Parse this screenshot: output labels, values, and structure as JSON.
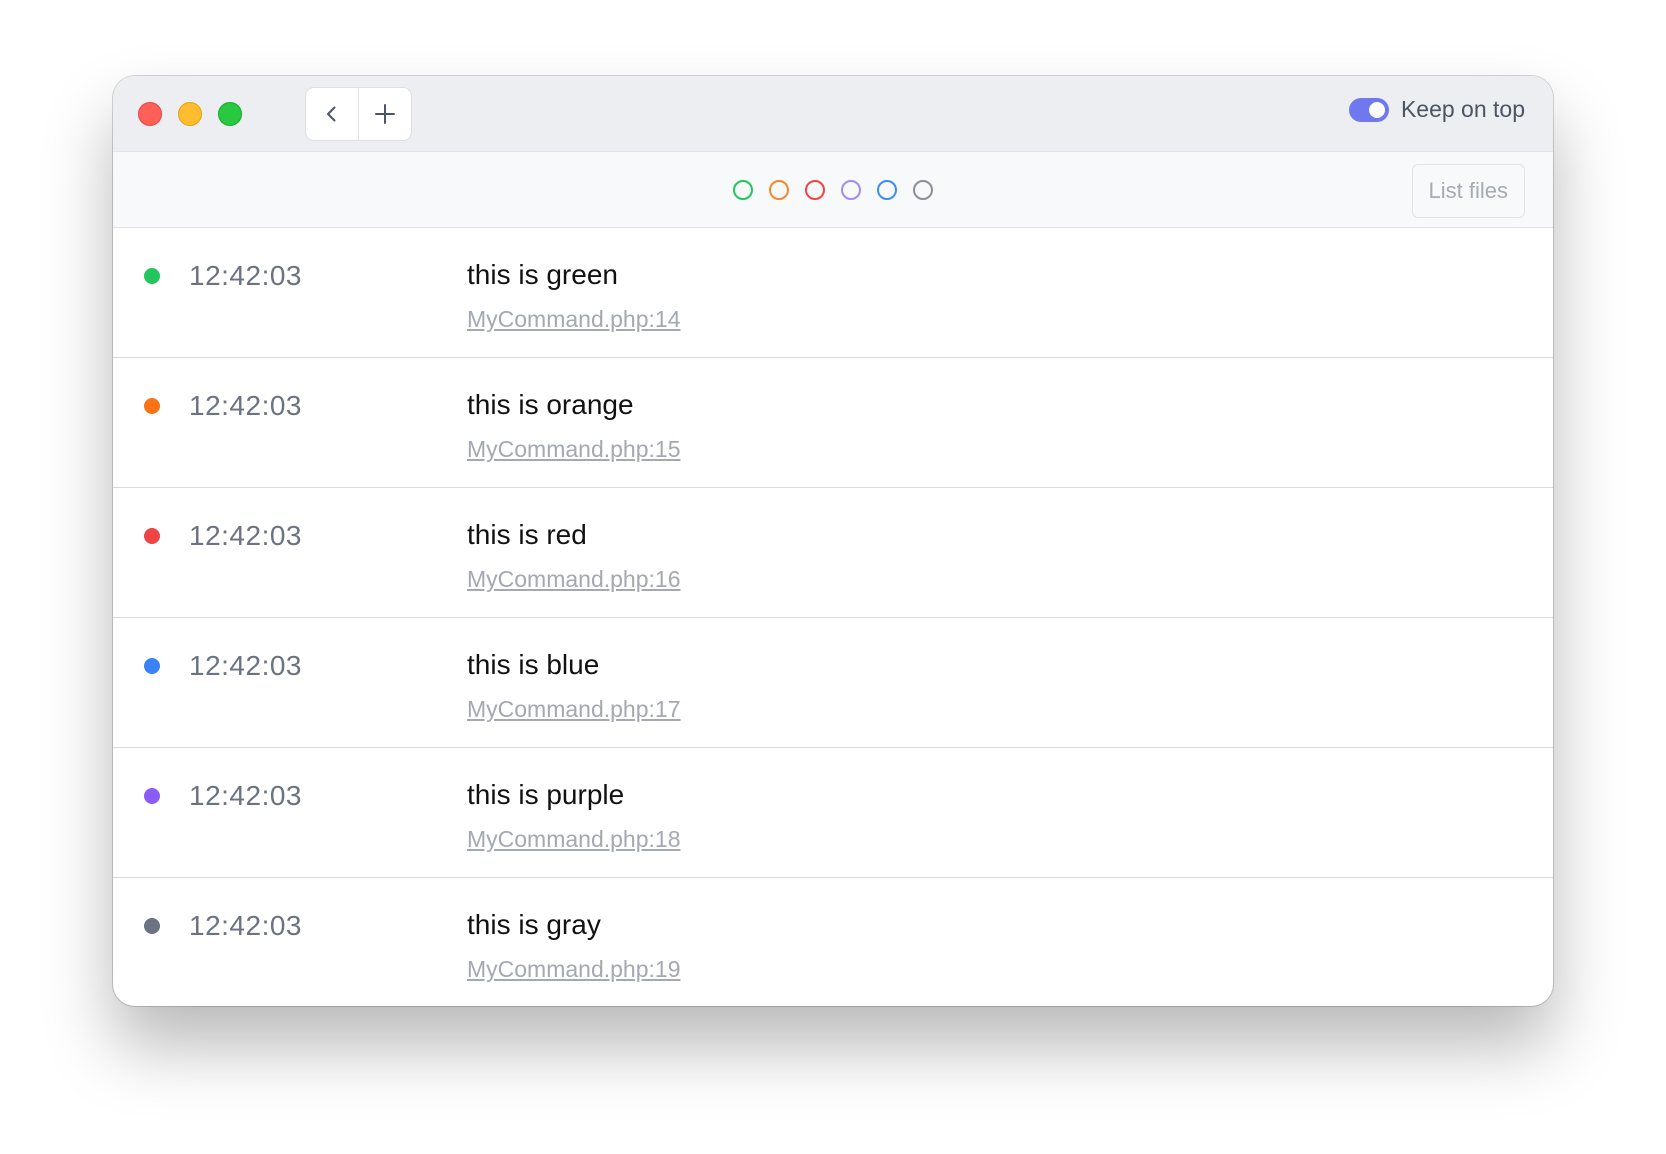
{
  "titlebar": {
    "back_icon": "chevron-left-icon",
    "add_icon": "plus-icon",
    "keep_on_top": {
      "label": "Keep on top",
      "enabled": true,
      "color": "#6f78ee"
    }
  },
  "filters": {
    "colors": [
      {
        "name": "green",
        "color": "#22c55e"
      },
      {
        "name": "orange",
        "color": "#f08a28"
      },
      {
        "name": "red",
        "color": "#ef4444"
      },
      {
        "name": "purple",
        "color": "#a58af0"
      },
      {
        "name": "blue",
        "color": "#3b8ff0"
      },
      {
        "name": "gray",
        "color": "#8a8f98"
      }
    ],
    "list_files_label": "List files"
  },
  "entries": [
    {
      "color": "#22c55e",
      "time": "12:42:03",
      "message": "this is green",
      "source": "MyCommand.php:14"
    },
    {
      "color": "#f97316",
      "time": "12:42:03",
      "message": "this is orange",
      "source": "MyCommand.php:15"
    },
    {
      "color": "#ef4444",
      "time": "12:42:03",
      "message": "this is red",
      "source": "MyCommand.php:16"
    },
    {
      "color": "#3b82f6",
      "time": "12:42:03",
      "message": "this is blue",
      "source": "MyCommand.php:17"
    },
    {
      "color": "#8b5cf6",
      "time": "12:42:03",
      "message": "this is purple",
      "source": "MyCommand.php:18"
    },
    {
      "color": "#6b7280",
      "time": "12:42:03",
      "message": "this is gray",
      "source": "MyCommand.php:19"
    }
  ]
}
